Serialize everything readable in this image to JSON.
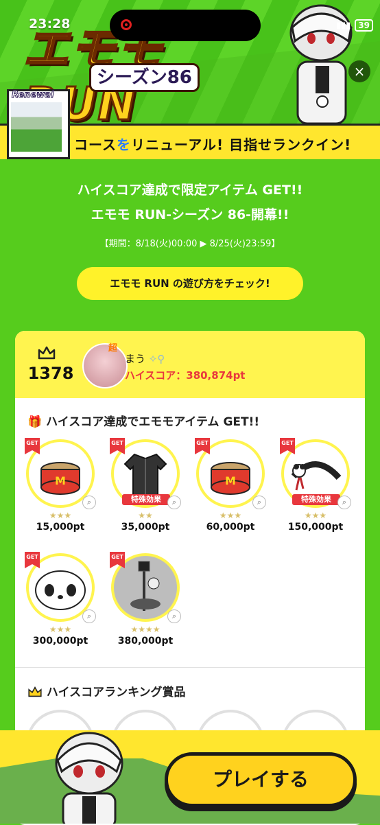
{
  "status": {
    "time": "23:28",
    "battery": "39"
  },
  "banner": {
    "logo_main": "エモモRUN",
    "logo_sub": "シーズン86",
    "thumb_label": "Renewal",
    "ribbon_parts": [
      "コース",
      "を",
      "リニューアル",
      "! 目指せランクイン!"
    ],
    "close": "×"
  },
  "intro": {
    "line1": "ハイスコア達成で限定アイテム GET!!",
    "line2": "エモモ RUN-シーズン 86-開幕!!",
    "period": "【期間：8/18(火)00:00 ▶ 8/25(火)23:59】",
    "howto_button": "エモモ RUN の遊び方をチェック!"
  },
  "ranking": {
    "rank": "1378",
    "badge": "超",
    "name": "まう",
    "score": "ハイスコア：380,874pt"
  },
  "items_section": {
    "title": "ハイスコア達成でエモモアイテム GET!!",
    "get_label": "GET",
    "items": [
      {
        "pt": "15,000pt",
        "stars": "★★★",
        "effect": "",
        "icon": "can-icon"
      },
      {
        "pt": "35,000pt",
        "stars": "★★",
        "effect": "特殊効果",
        "icon": "shirt-icon"
      },
      {
        "pt": "60,000pt",
        "stars": "★★★",
        "effect": "",
        "icon": "can-icon"
      },
      {
        "pt": "150,000pt",
        "stars": "★★★",
        "effect": "特殊効果",
        "icon": "headband-icon"
      },
      {
        "pt": "300,000pt",
        "stars": "★★★",
        "effect": "",
        "icon": "panda-icon"
      },
      {
        "pt": "380,000pt",
        "stars": "★★★★",
        "effect": "",
        "icon": "lamp-icon"
      }
    ]
  },
  "prizes_section": {
    "title": "ハイスコアランキング賞品"
  },
  "play_button": "プレイする"
}
